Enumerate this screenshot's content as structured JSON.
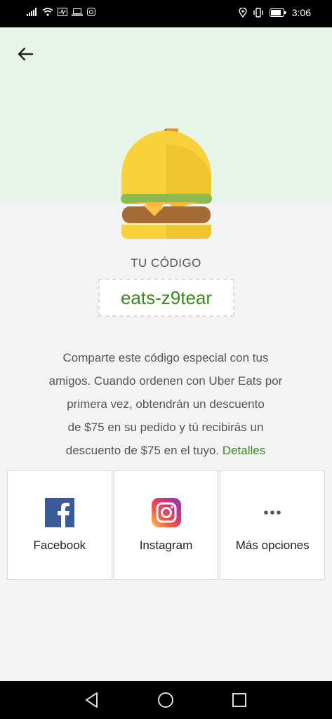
{
  "status_bar": {
    "time": "3:06",
    "icons_left": [
      "signal-icon",
      "wifi-icon",
      "activity-icon",
      "laptop-icon",
      "instagram-notification-icon"
    ],
    "icons_right": [
      "location-icon",
      "vibrate-icon",
      "battery-icon"
    ]
  },
  "header": {
    "back_icon": "arrow-left-icon",
    "background_color": "#e8f6e8"
  },
  "promo": {
    "code_label": "TU CÓDIGO",
    "code": "eats-z9tear",
    "description_lines": [
      "Comparte este código especial con tus",
      "amigos. Cuando ordenen con Uber Eats por",
      "primera vez, obtendrán un descuento",
      "de $75 en su pedido y tú recibirás un",
      "descuento de $75 en el tuyo."
    ],
    "details_link": "Detalles",
    "accent_color": "#3a8a21"
  },
  "share": {
    "options": [
      {
        "label": "Facebook",
        "icon": "facebook-icon"
      },
      {
        "label": "Instagram",
        "icon": "instagram-icon"
      },
      {
        "label": "Más opciones",
        "icon": "more-horizontal-icon"
      }
    ]
  },
  "nav_bar": {
    "buttons": [
      "back-triangle-icon",
      "home-circle-icon",
      "recents-square-icon"
    ]
  }
}
